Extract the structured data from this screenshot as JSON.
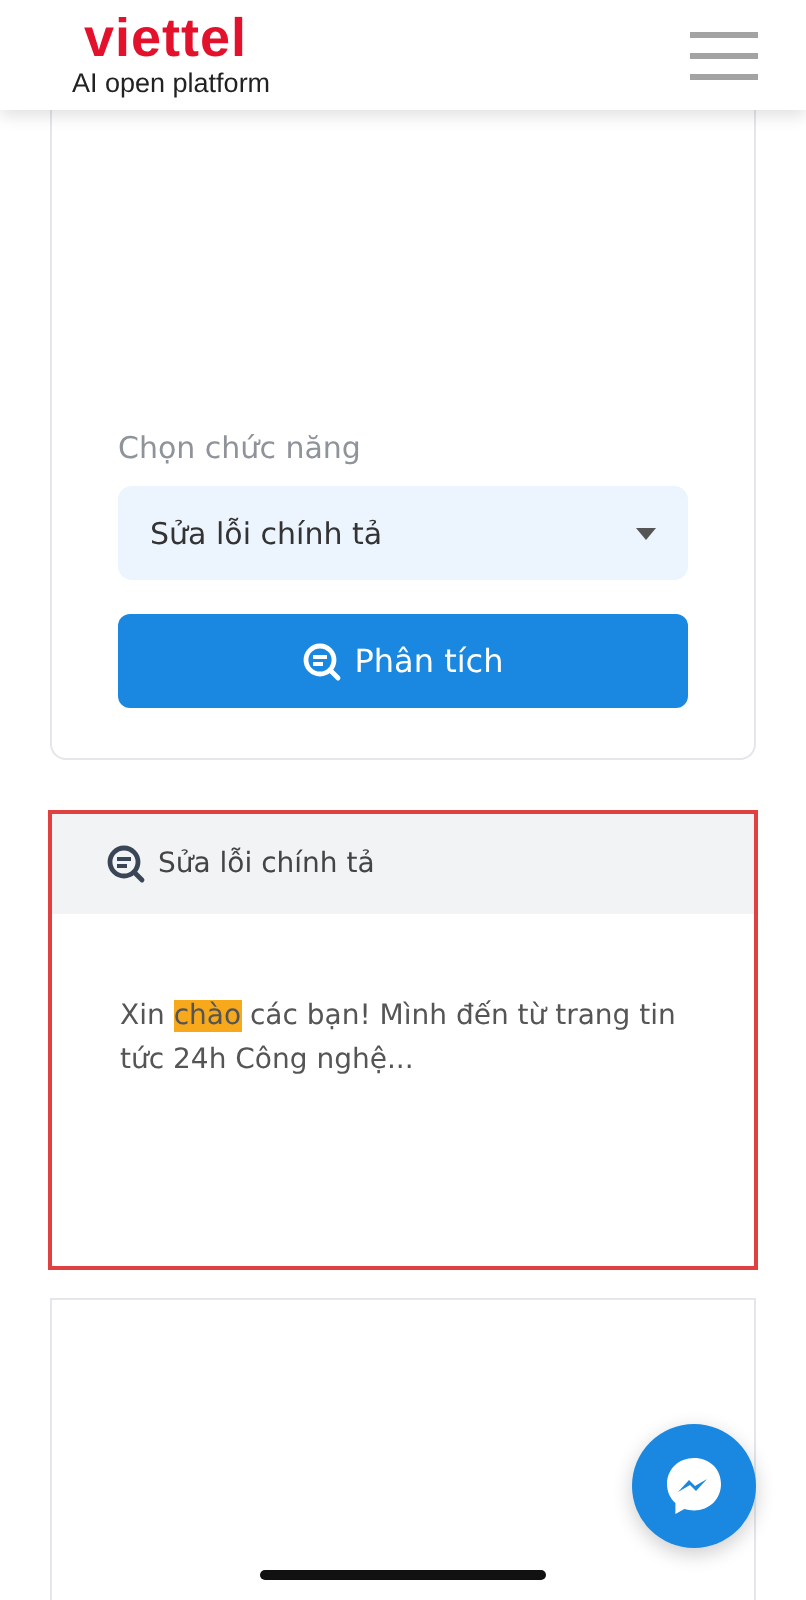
{
  "header": {
    "logo": "viettel",
    "tagline": "AI open platform"
  },
  "form": {
    "label": "Chọn chức năng",
    "select_value": "Sửa lỗi chính tả",
    "analyze_button": "Phân tích"
  },
  "result": {
    "title": "Sửa lỗi chính tả",
    "segments": [
      {
        "text": "Xin ",
        "highlighted": false
      },
      {
        "text": "chào",
        "highlighted": true
      },
      {
        "text": " các bạn! Mình đến từ trang tin tức 24h Công nghệ...",
        "highlighted": false
      }
    ]
  }
}
